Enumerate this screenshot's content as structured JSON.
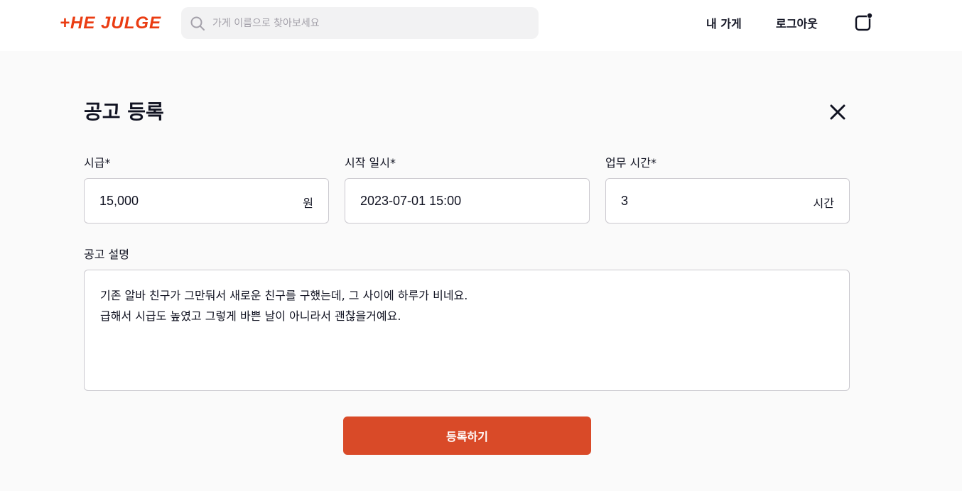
{
  "header": {
    "logo_text": "+HE JULGE",
    "search_placeholder": "가게 이름으로 찾아보세요",
    "nav_my_store": "내 가게",
    "nav_logout": "로그아웃"
  },
  "form": {
    "title": "공고 등록",
    "wage": {
      "label": "시급*",
      "value": "15,000",
      "unit": "원"
    },
    "start": {
      "label": "시작 일시*",
      "value": "2023-07-01 15:00"
    },
    "duration": {
      "label": "업무 시간*",
      "value": "3",
      "unit": "시간"
    },
    "description": {
      "label": "공고 설명",
      "lines": [
        "기존 알바 친구가 그만둬서 새로운 친구를 구했는데, 그 사이에 하루가 비네요.",
        "급해서 시급도 높였고 그렇게 바쁜 날이 아니라서 괜찮을거예요."
      ]
    },
    "submit_label": "등록하기"
  },
  "colors": {
    "accent": "#ea3c12",
    "button": "#d94a28",
    "background": "#fafafa",
    "border": "#cbc9cf"
  },
  "icons": {
    "search": "search-icon",
    "notification": "notification-icon",
    "close": "close-icon"
  }
}
